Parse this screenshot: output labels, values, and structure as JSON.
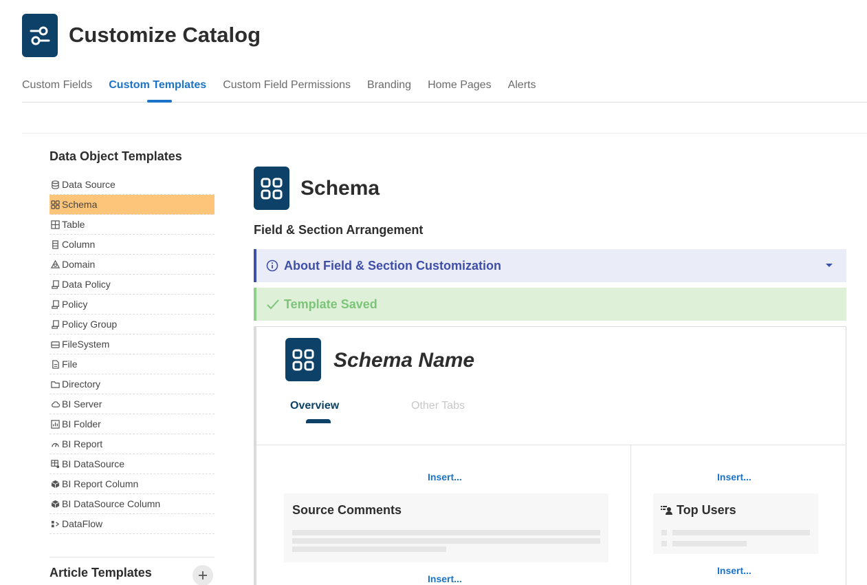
{
  "header": {
    "title": "Customize Catalog",
    "logo_icon": "sliders-icon"
  },
  "tabs": [
    {
      "label": "Custom Fields",
      "active": false
    },
    {
      "label": "Custom Templates",
      "active": true
    },
    {
      "label": "Custom Field Permissions",
      "active": false
    },
    {
      "label": "Branding",
      "active": false
    },
    {
      "label": "Home Pages",
      "active": false
    },
    {
      "label": "Alerts",
      "active": false
    }
  ],
  "sidebar": {
    "heading": "Data Object Templates",
    "items": [
      {
        "label": "Data Source",
        "icon": "database-icon"
      },
      {
        "label": "Schema",
        "icon": "grid-icon",
        "active": true
      },
      {
        "label": "Table",
        "icon": "table-icon"
      },
      {
        "label": "Column",
        "icon": "column-icon"
      },
      {
        "label": "Domain",
        "icon": "domain-icon"
      },
      {
        "label": "Data Policy",
        "icon": "scroll-icon"
      },
      {
        "label": "Policy",
        "icon": "scroll-icon"
      },
      {
        "label": "Policy Group",
        "icon": "scroll-icon"
      },
      {
        "label": "FileSystem",
        "icon": "drive-icon"
      },
      {
        "label": "File",
        "icon": "file-icon"
      },
      {
        "label": "Directory",
        "icon": "folder-icon"
      },
      {
        "label": "BI Server",
        "icon": "cloud-icon"
      },
      {
        "label": "BI Folder",
        "icon": "bar-chart-icon"
      },
      {
        "label": "BI Report",
        "icon": "gauge-icon"
      },
      {
        "label": "BI DataSource",
        "icon": "table-user-icon"
      },
      {
        "label": "BI Report Column",
        "icon": "cube-icon"
      },
      {
        "label": "BI DataSource Column",
        "icon": "cube-icon"
      },
      {
        "label": "DataFlow",
        "icon": "dataflow-icon"
      }
    ],
    "article_heading": "Article Templates"
  },
  "main": {
    "title": "Schema",
    "section_heading": "Field & Section Arrangement",
    "info_banner": "About Field & Section Customization",
    "success_banner": "Template Saved"
  },
  "preview": {
    "title": "Schema Name",
    "tabs": [
      "Overview",
      "Other Tabs"
    ],
    "insert_label": "Insert...",
    "card_left_title": "Source Comments",
    "card_right_title": "Top Users"
  },
  "colors": {
    "brand": "#0e4168",
    "accent": "#1a73c6",
    "active_item": "#fdc57a",
    "info": "#3f4fa8",
    "success": "#7cc47a"
  }
}
